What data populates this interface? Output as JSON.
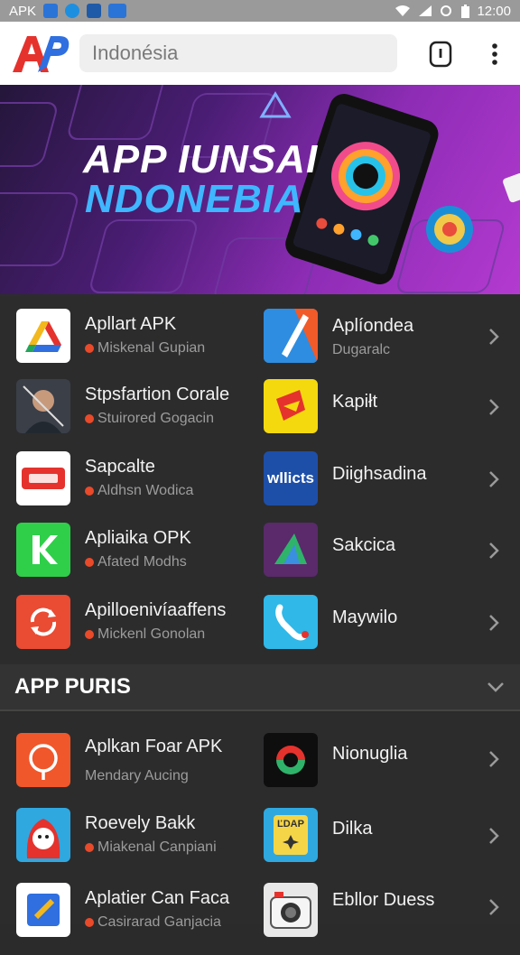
{
  "status": {
    "left_label": "APK",
    "time": "12:00"
  },
  "search": {
    "value": "Indonésia"
  },
  "banner": {
    "line1": "APP IUNSAI",
    "line2": "NDONEBIA"
  },
  "rows1": [
    {
      "left": {
        "name": "Apllart APK",
        "sub": "Miskenal Gupian",
        "icon": "drive-icon"
      },
      "right": {
        "name": "Aplíondea",
        "sub": "Dugaralc",
        "icon": "wedge-icon"
      }
    },
    {
      "left": {
        "name": "Stpsfartion Corale",
        "sub": "Stuirored Gogacin",
        "icon": "portrait-icon"
      },
      "right": {
        "name": "Kapiłt",
        "sub": "",
        "icon": "fold-icon"
      }
    },
    {
      "left": {
        "name": "Sapcalte",
        "sub": "Aldhsn Wodica",
        "icon": "badge-icon"
      },
      "right": {
        "name": "Diighsadina",
        "sub": "",
        "icon": "wllicts-icon",
        "icon_text": "wllicts"
      }
    },
    {
      "left": {
        "name": "Apliaika OPK",
        "sub": "Afated Modhs",
        "icon": "k-icon"
      },
      "right": {
        "name": "Sakcica",
        "sub": "",
        "icon": "triangle-icon"
      }
    },
    {
      "left": {
        "name": "Apilloenivíaaffens",
        "sub": "Mickenl Gonolan",
        "icon": "refresh-icon"
      },
      "right": {
        "name": "Maywilo",
        "sub": "",
        "icon": "phone-icon"
      }
    }
  ],
  "section": {
    "title": "APP PURIS"
  },
  "rows2": [
    {
      "left": {
        "name": "Aplkan Foar APK",
        "sub": "Mendary Aucing",
        "icon": "pin-icon"
      },
      "right": {
        "name": "Nionuglia",
        "sub": "",
        "icon": "ring-icon"
      }
    },
    {
      "left": {
        "name": "Roevely Bakk",
        "sub": "Miakenal Canpiani",
        "icon": "face-icon"
      },
      "right": {
        "name": "Dilka",
        "sub": "",
        "icon": "card-icon",
        "icon_text": "ĽDAP"
      }
    },
    {
      "left": {
        "name": "Aplatier Can Faca",
        "sub": "Casirarad Ganjacia",
        "icon": "tile-icon"
      },
      "right": {
        "name": "Ebllor Duess",
        "sub": "",
        "icon": "camera-icon"
      }
    }
  ],
  "colors": {
    "accent_blue": "#3fb6ff",
    "banner_purple": "#8d2cb5",
    "logo_red": "#e5322d",
    "logo_blue": "#2f6fe0"
  }
}
